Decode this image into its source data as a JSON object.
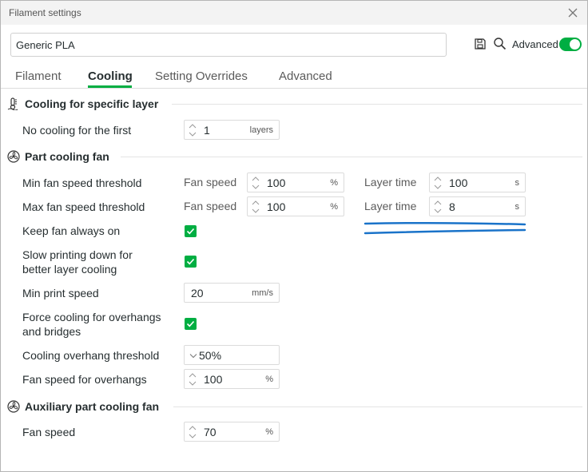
{
  "window": {
    "title": "Filament settings"
  },
  "preset": {
    "value": "Generic PLA"
  },
  "header": {
    "advanced_label": "Advanced",
    "advanced_on": true
  },
  "tabs": [
    {
      "label": "Filament",
      "active": false
    },
    {
      "label": "Cooling",
      "active": true
    },
    {
      "label": "Setting Overrides",
      "active": false
    },
    {
      "label": "Advanced",
      "active": false
    }
  ],
  "sections": {
    "specific_layer": {
      "title": "Cooling for specific layer",
      "no_cooling": {
        "label": "No cooling for the first",
        "value": "1",
        "unit": "layers"
      }
    },
    "part_fan": {
      "title": "Part cooling fan",
      "min_threshold": {
        "label": "Min fan speed threshold",
        "fan_label": "Fan speed",
        "fan_value": "100",
        "fan_unit": "%",
        "layer_label": "Layer time",
        "layer_value": "100",
        "layer_unit": "s"
      },
      "max_threshold": {
        "label": "Max fan speed threshold",
        "fan_label": "Fan speed",
        "fan_value": "100",
        "fan_unit": "%",
        "layer_label": "Layer time",
        "layer_value": "8",
        "layer_unit": "s"
      },
      "keep_fan_on": {
        "label": "Keep fan always on",
        "checked": true
      },
      "slow_down": {
        "label_line1": "Slow printing down for",
        "label_line2": "better layer cooling",
        "checked": true
      },
      "min_print_speed": {
        "label": "Min print speed",
        "value": "20",
        "unit": "mm/s"
      },
      "force_overhangs": {
        "label_line1": "Force cooling for overhangs",
        "label_line2": "and bridges",
        "checked": true
      },
      "overhang_threshold": {
        "label": "Cooling overhang threshold",
        "value": "50%"
      },
      "overhang_fan_speed": {
        "label": "Fan speed for overhangs",
        "value": "100",
        "unit": "%"
      }
    },
    "aux_fan": {
      "title": "Auxiliary part cooling fan",
      "fan_speed": {
        "label": "Fan speed",
        "value": "70",
        "unit": "%"
      }
    }
  },
  "colors": {
    "accent": "#00ae42",
    "annotation": "#1a73c9"
  }
}
